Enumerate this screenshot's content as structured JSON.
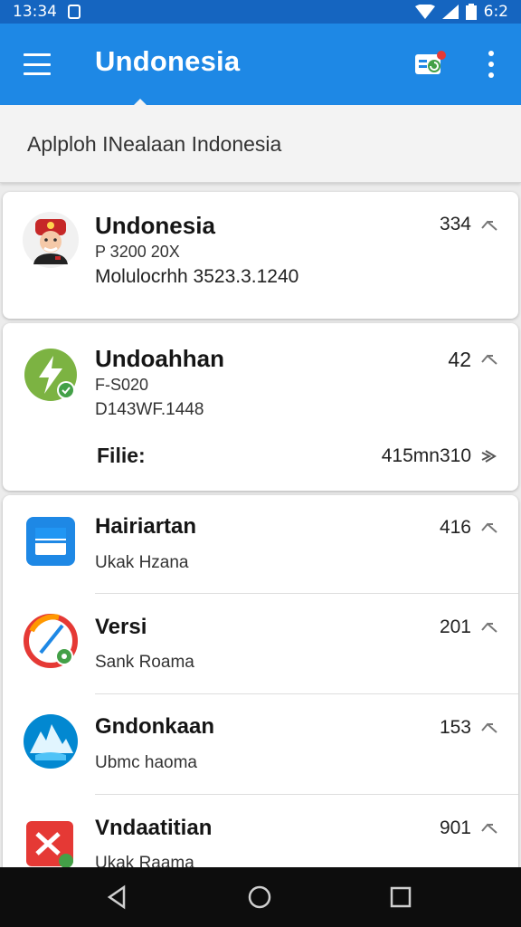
{
  "status_bar": {
    "time": "13:34",
    "battery": "6:2"
  },
  "app_bar": {
    "title": "Undonesia",
    "badge_color": "#e53935"
  },
  "subheader": {
    "text": "Aplploh INealaan Indonesia"
  },
  "card1": {
    "title": "Undonesia",
    "sub": "P 3200 20X",
    "line": "Molulocrhh 3523.3.1240",
    "count": "334"
  },
  "card2": {
    "title": "Undoahhan",
    "sub": "F-S020",
    "line": "D143WF.1448",
    "file_label": "Filie:",
    "file_value": "415mn310",
    "count": "42"
  },
  "list": [
    {
      "title": "Hairiartan",
      "sub": "Ukak Hzana",
      "count": "416",
      "icon": "window-app-icon"
    },
    {
      "title": "Versi",
      "sub": "Sank Roama",
      "count": "201",
      "icon": "gauge-app-icon"
    },
    {
      "title": "Gndonkaan",
      "sub": "Ubmc haoma",
      "count": "153",
      "icon": "mountain-app-icon"
    },
    {
      "title": "Vndaatitian",
      "sub": "Ukak Raama",
      "count": "901",
      "icon": "cross-app-icon"
    }
  ],
  "colors": {
    "primary": "#1e88e5",
    "status": "#1565c0",
    "accent_green": "#43a047"
  }
}
